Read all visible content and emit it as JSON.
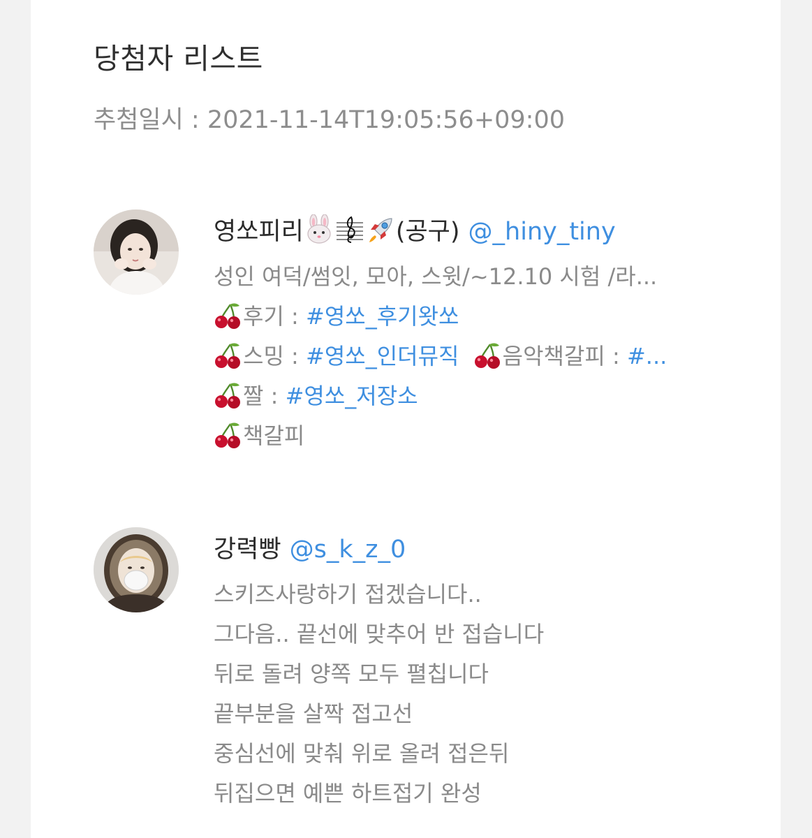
{
  "page": {
    "title": "당첨자 리스트",
    "draw_date_label": "추첨일시 : 2021-11-14T19:05:56+09:00"
  },
  "winners": [
    {
      "display_name": "영쏘피리",
      "display_suffix": "(공구)",
      "handle": "@_hiny_tiny",
      "name_emoji_icons": [
        "rabbit-face-icon",
        "musical-score-icon",
        "rocket-icon"
      ],
      "bio": {
        "line1": "성인 여덕/썸잇, 모아, 스윗/~12.10 시험 /라...",
        "line2_label": "후기 : ",
        "line2_tag": "#영쏘_후기왓쏘",
        "line3_label": "스밍 : ",
        "line3_tag": "#영쏘_인더뮤직",
        "line3_label2": "음악책갈피 : ",
        "line3_tag2": "#...",
        "line4_label": "짤 : ",
        "line4_tag": "#영쏘_저장소",
        "line5_label": "책갈피"
      }
    },
    {
      "display_name": "강력빵",
      "handle": "@s_k_z_0",
      "bio_lines": [
        "스키즈사랑하기 접겠습니다..",
        "그다음.. 끝선에 맞추어 반 접습니다",
        "뒤로 돌려 양쪽 모두 펼칩니다",
        "끝부분을 살짝 접고선",
        "중심선에 맞춰 위로 올려 접은뒤",
        "뒤집으면 예쁜 하트접기 완성"
      ]
    }
  ],
  "colors": {
    "background": "#f2f2f2",
    "card": "#ffffff",
    "title_text": "#2f2f2f",
    "muted_text": "#8a8a8a",
    "link": "#3f8fe0",
    "cherry": "#c8102e"
  }
}
